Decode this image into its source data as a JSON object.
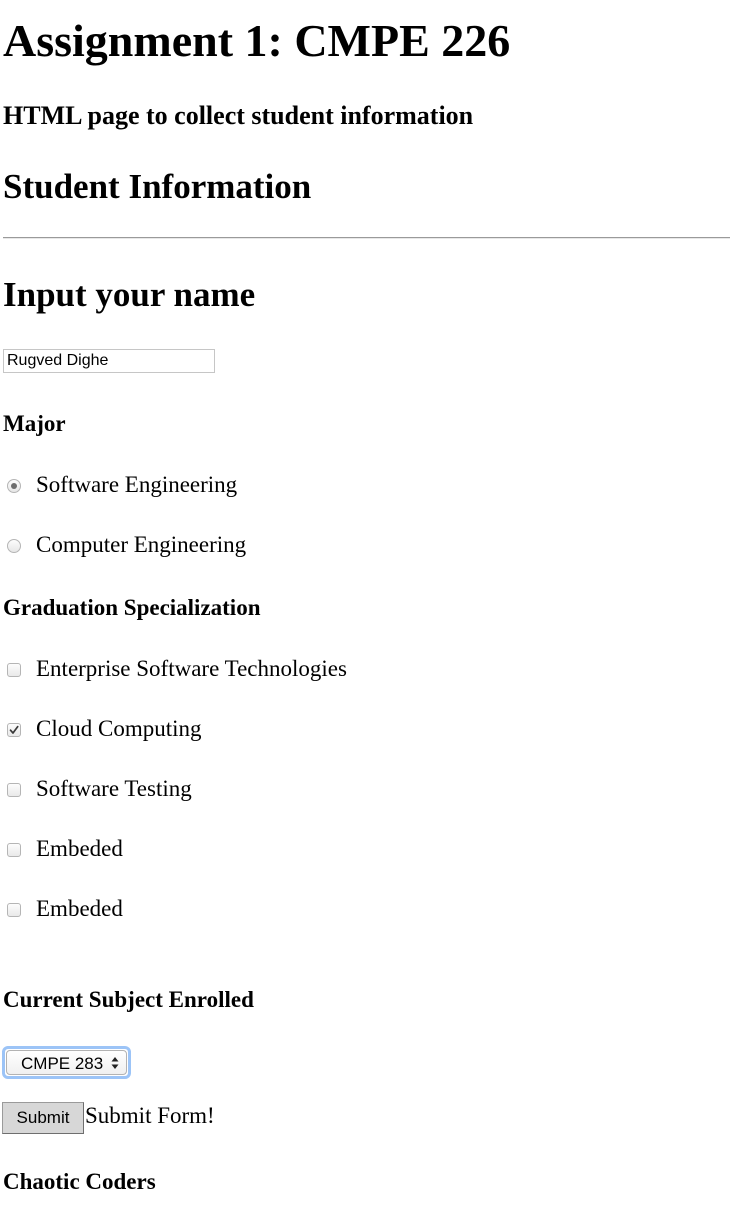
{
  "header": {
    "title": "Assignment 1: CMPE 226",
    "subtitle": "HTML page to collect student information",
    "section_title": "Student Information"
  },
  "name_section": {
    "heading": "Input your name",
    "value": "Rugved Dighe",
    "placeholder": ""
  },
  "major": {
    "label": "Major",
    "options": [
      {
        "label": "Software Engineering",
        "checked": true
      },
      {
        "label": "Computer Engineering",
        "checked": false
      }
    ]
  },
  "specialization": {
    "label": "Graduation Specialization",
    "options": [
      {
        "label": "Enterprise Software Technologies",
        "checked": false
      },
      {
        "label": "Cloud Computing",
        "checked": true
      },
      {
        "label": "Software Testing",
        "checked": false
      },
      {
        "label": "Embeded",
        "checked": false
      },
      {
        "label": "Embeded",
        "checked": false
      }
    ]
  },
  "subject": {
    "label": "Current Subject Enrolled",
    "selected": "CMPE 283"
  },
  "submit": {
    "button_label": "Submit",
    "text": "Submit Form!"
  },
  "footer": {
    "team": "Chaotic Coders"
  },
  "colors": {
    "focus_ring": "#9cc4f7",
    "button_bg": "#d7d7d7"
  }
}
